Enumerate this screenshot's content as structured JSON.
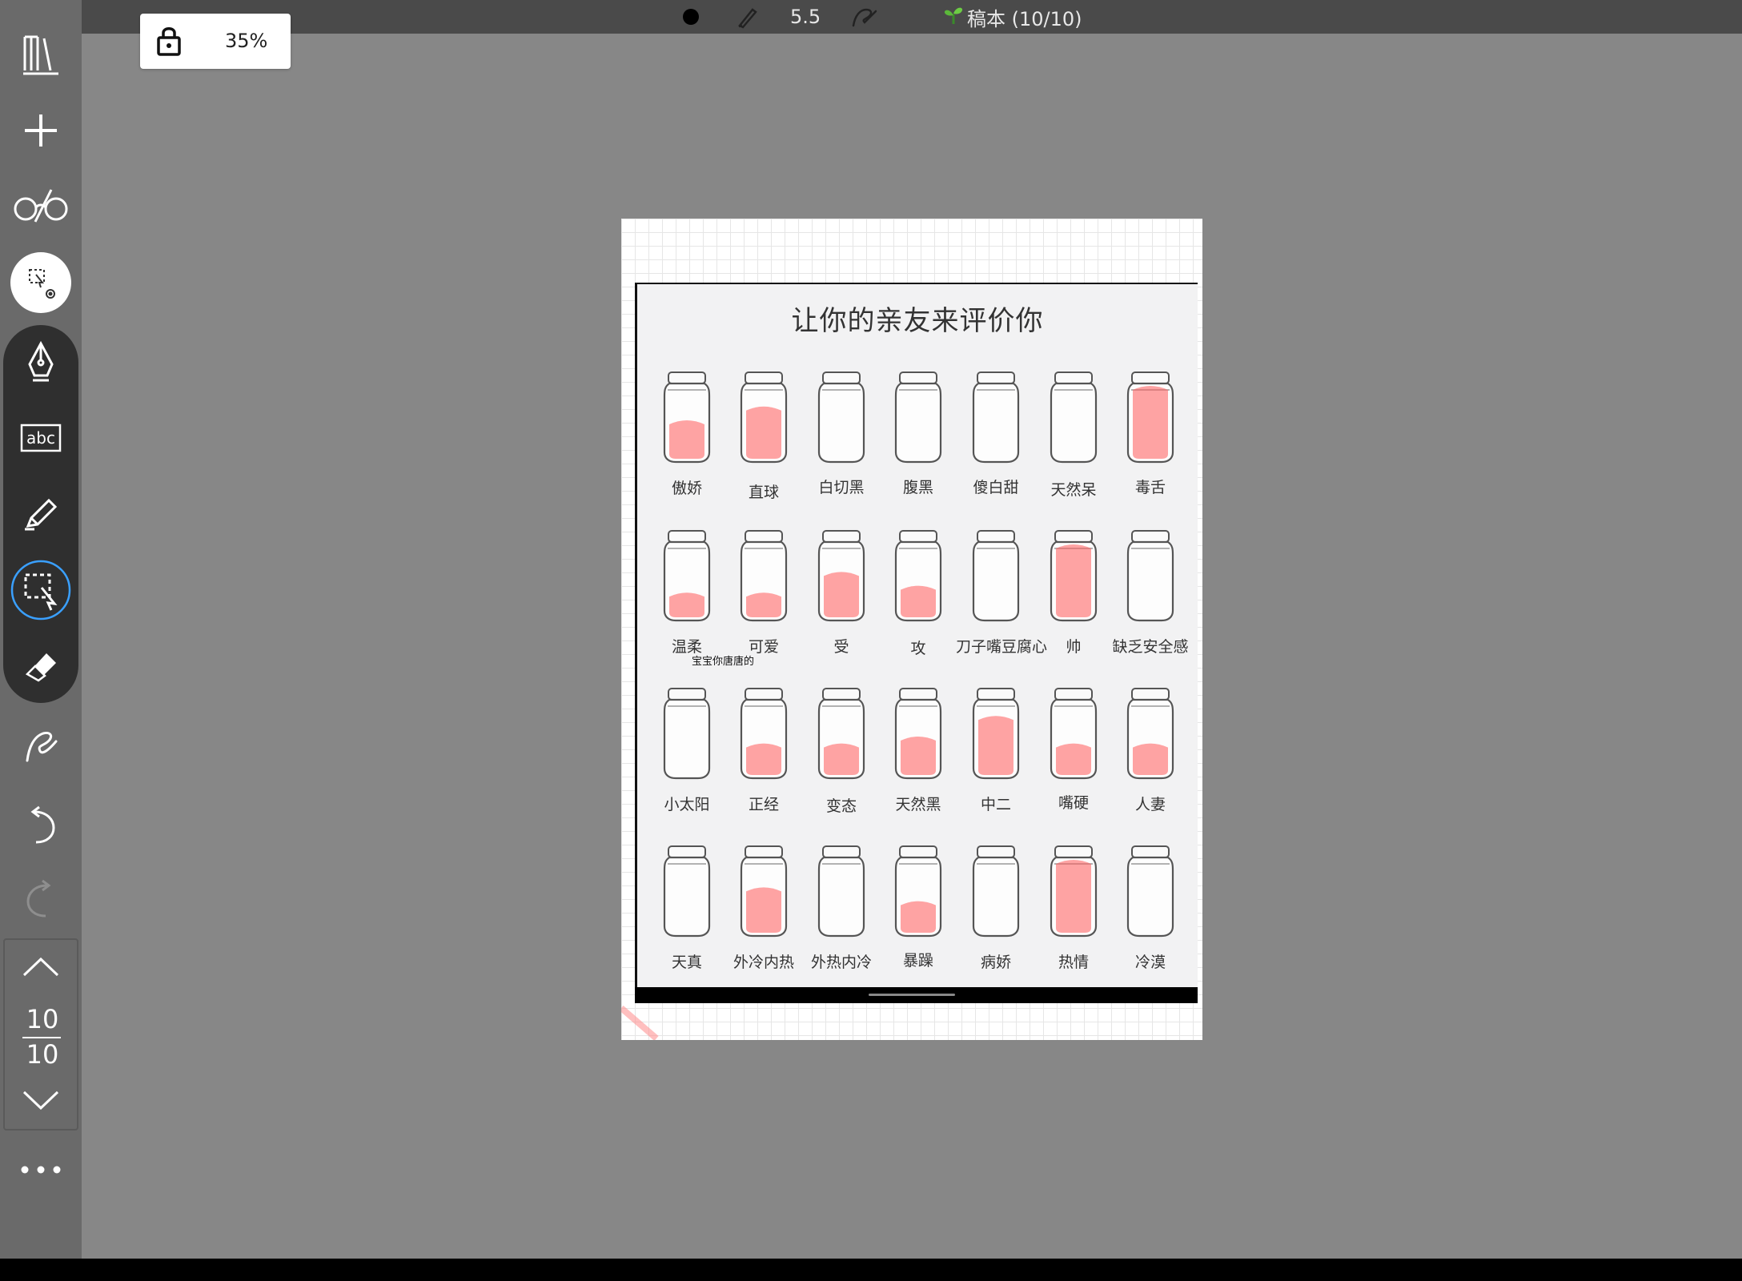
{
  "status_bar": {
    "pen_size": "5.5",
    "notebook_title": "稿本 (10/10)",
    "icons": [
      "pen-color-dot-icon",
      "brush-icon",
      "pen-size-value",
      "stroke-style-icon",
      "sprout-icon"
    ]
  },
  "zoom_badge": {
    "lock_icon": "lock-icon",
    "zoom_level": "35%"
  },
  "sidebar": {
    "tools": [
      {
        "name": "library-icon"
      },
      {
        "name": "add-page-icon"
      },
      {
        "name": "reading-glasses-icon"
      },
      {
        "name": "lasso-settings-icon",
        "active": true
      },
      {
        "name": "fountain-pen-icon"
      },
      {
        "name": "text-box-icon",
        "label": "abc"
      },
      {
        "name": "highlighter-icon"
      },
      {
        "name": "lasso-select-icon",
        "active": true
      },
      {
        "name": "eraser-icon"
      },
      {
        "name": "gesture-icon"
      },
      {
        "name": "undo-icon"
      },
      {
        "name": "redo-icon"
      }
    ],
    "page_nav": {
      "current_page": "10",
      "total_pages": "10"
    },
    "more_icon": "more-horizontal-icon"
  },
  "document": {
    "title": "让你的亲友来评价你",
    "note": "宝宝你唐唐的",
    "jar_rows": [
      [
        "傲娇",
        "直球",
        "白切黑",
        "腹黑",
        "傻白甜",
        "天然呆",
        "毒舌"
      ],
      [
        "温柔",
        "可爱",
        "受",
        "攻",
        "刀子嘴豆腐心",
        "帅",
        "缺乏安全感"
      ],
      [
        "小太阳",
        "正经",
        "变态",
        "天然黑",
        "中二",
        "嘴硬",
        "人妻"
      ],
      [
        "天真",
        "外冷内热",
        "外热内冷",
        "暴躁",
        "病娇",
        "热情",
        "冷漠"
      ]
    ],
    "jar_fill_levels": [
      [
        0.5,
        0.7,
        0,
        0,
        0,
        0,
        1.0
      ],
      [
        0.3,
        0.3,
        0.6,
        0.4,
        0,
        1.0,
        0
      ],
      [
        0,
        0.4,
        0.4,
        0.5,
        0.8,
        0.4,
        0.4
      ],
      [
        0,
        0.6,
        0,
        0.4,
        0,
        1.0,
        0
      ]
    ],
    "colors": {
      "ink": "#ff5a5a",
      "canvas": "#878787",
      "toolbar": "#6a6a6a",
      "tool_group": "#2f2f2f",
      "active_ring": "#3aa0ff"
    }
  }
}
